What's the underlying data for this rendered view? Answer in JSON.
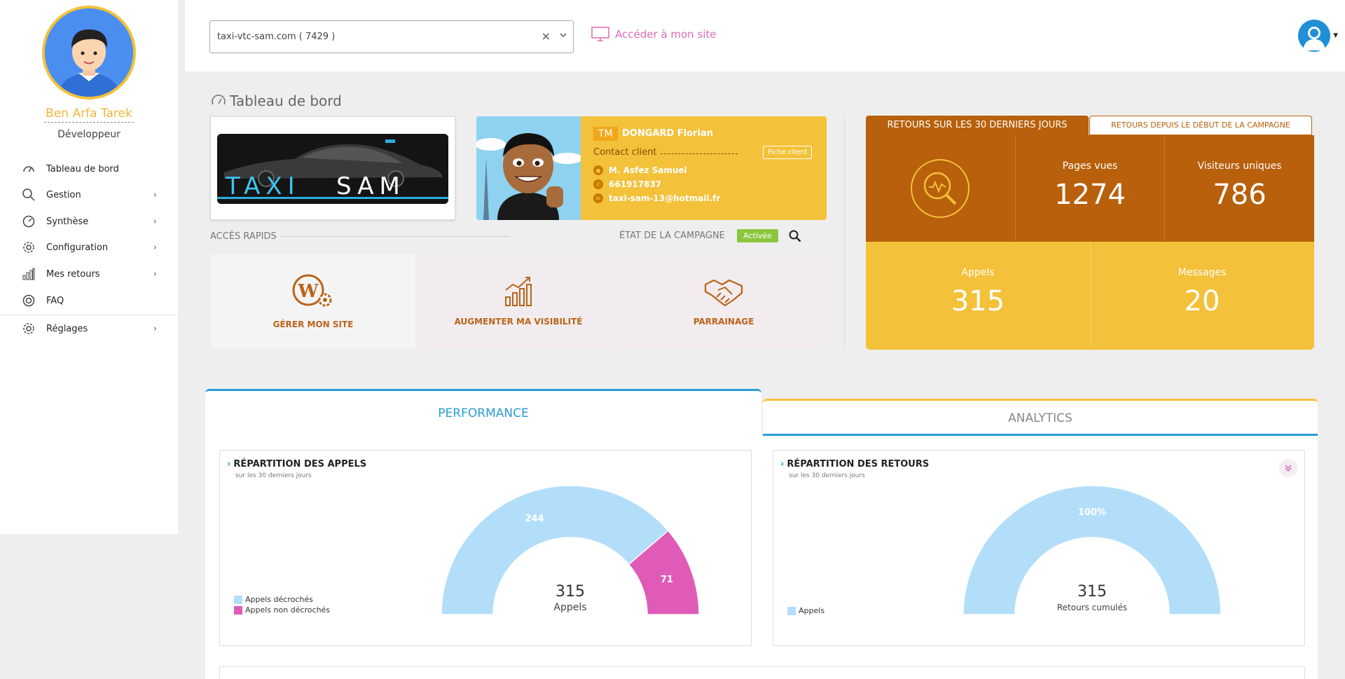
{
  "user": {
    "name": "Ben Arfa Tarek",
    "role": "Développeur"
  },
  "sidebar": {
    "items": [
      {
        "label": "Tableau de bord",
        "icon": "dashboard-icon",
        "has_submenu": false
      },
      {
        "label": "Gestion",
        "icon": "search-icon",
        "has_submenu": true
      },
      {
        "label": "Synthèse",
        "icon": "gauge-icon",
        "has_submenu": true
      },
      {
        "label": "Configuration",
        "icon": "gear-icon",
        "has_submenu": true
      },
      {
        "label": "Mes retours",
        "icon": "bar-chart-icon",
        "has_submenu": true
      },
      {
        "label": "FAQ",
        "icon": "lifebuoy-icon",
        "has_submenu": false
      },
      {
        "label": "Réglages",
        "icon": "gear-icon",
        "has_submenu": true
      }
    ]
  },
  "topbar": {
    "site_select_value": "taxi-vtc-sam.com ( 7429 )",
    "site_link_label": "Accéder à mon site"
  },
  "dashboard": {
    "title": "Tableau de bord",
    "logo_text_left": "TAXI",
    "logo_text_right": "SAM",
    "client": {
      "initials": "TM",
      "name": "DONGARD Florian",
      "contact_label": "Contact client",
      "fiche_button": "Fiche client",
      "contact_person": "M. Asfez Samuel",
      "phone": "661917837",
      "email": "taxi-sam-13@hotmail.fr"
    },
    "quick_access_title": "ACCÈS RAPIDS",
    "campaign_state_label": "ÉTAT DE LA CAMPAGNE",
    "campaign_state_value": "Activée",
    "quick_tiles": [
      {
        "label": "GÉRER MON SITE",
        "icon": "wordpress-gear-icon"
      },
      {
        "label": "AUGMENTER MA VISIBILITÉ",
        "icon": "growth-chart-icon"
      },
      {
        "label": "PARRAINAGE",
        "icon": "handshake-icon"
      }
    ]
  },
  "stats": {
    "tab_active": "RETOURS SUR LES 30 DERNIERS JOURS",
    "tab_inactive": "RETOURS DEPUIS LE DÉBUT DE LA CAMPAGNE",
    "pages_vues_label": "Pages vues",
    "pages_vues_value": "1274",
    "visiteurs_label": "Visiteurs uniques",
    "visiteurs_value": "786",
    "appels_label": "Appels",
    "appels_value": "315",
    "messages_label": "Messages",
    "messages_value": "20"
  },
  "tabs": {
    "performance": "PERFORMANCE",
    "analytics": "ANALYTICS"
  },
  "colors": {
    "accent_orange": "#b8600b",
    "accent_yellow": "#f3c13a",
    "accent_blue": "#2a9cd6",
    "light_blue": "#b3defa",
    "pink": "#e05bb8",
    "green": "#8cc63f"
  },
  "chart_data": [
    {
      "type": "pie",
      "title": "RÉPARTITION DES APPELS",
      "subtitle": "sur les 30 derniers jours",
      "series": [
        {
          "name": "Appels décrochés",
          "value": 244,
          "label": "244",
          "color": "#b3defa"
        },
        {
          "name": "Appels non décrochés",
          "value": 71,
          "label": "71",
          "color": "#e05bb8"
        }
      ],
      "center_value": "315",
      "center_label": "Appels"
    },
    {
      "type": "pie",
      "title": "RÉPARTITION DES RETOURS",
      "subtitle": "sur les 30 derniers jours",
      "series": [
        {
          "name": "Appels",
          "value": 315,
          "label": "100%",
          "color": "#b3defa"
        }
      ],
      "center_value": "315",
      "center_label": "Retours cumulés"
    }
  ]
}
